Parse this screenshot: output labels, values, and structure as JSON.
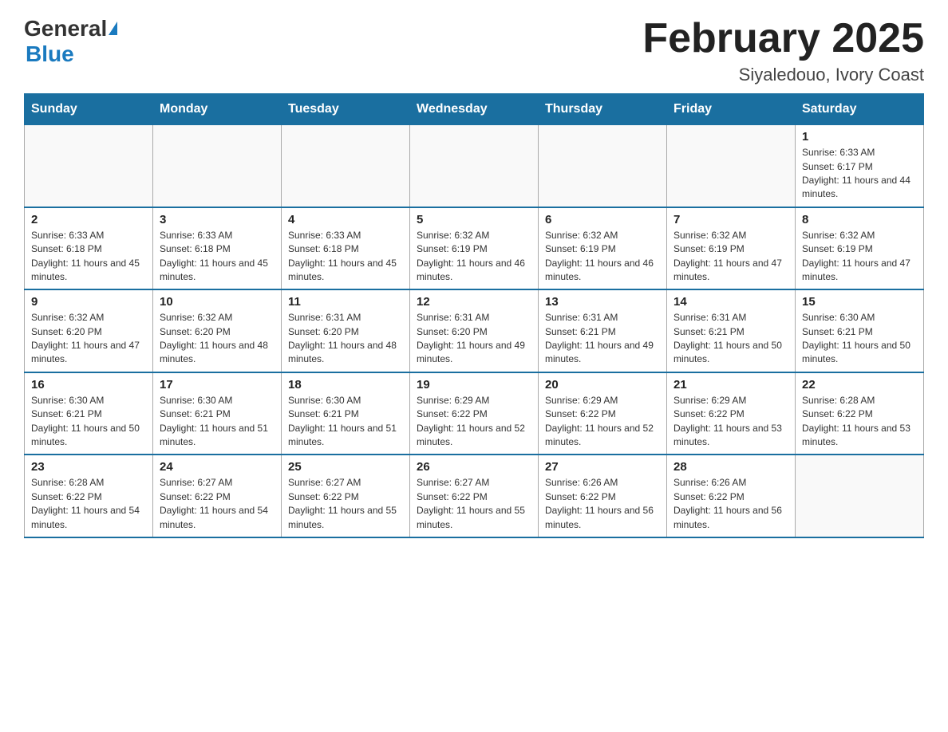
{
  "header": {
    "logo_general": "General",
    "logo_blue": "Blue",
    "month_title": "February 2025",
    "location": "Siyaledouo, Ivory Coast"
  },
  "weekdays": [
    "Sunday",
    "Monday",
    "Tuesday",
    "Wednesday",
    "Thursday",
    "Friday",
    "Saturday"
  ],
  "weeks": [
    [
      {
        "day": "",
        "info": ""
      },
      {
        "day": "",
        "info": ""
      },
      {
        "day": "",
        "info": ""
      },
      {
        "day": "",
        "info": ""
      },
      {
        "day": "",
        "info": ""
      },
      {
        "day": "",
        "info": ""
      },
      {
        "day": "1",
        "info": "Sunrise: 6:33 AM\nSunset: 6:17 PM\nDaylight: 11 hours and 44 minutes."
      }
    ],
    [
      {
        "day": "2",
        "info": "Sunrise: 6:33 AM\nSunset: 6:18 PM\nDaylight: 11 hours and 45 minutes."
      },
      {
        "day": "3",
        "info": "Sunrise: 6:33 AM\nSunset: 6:18 PM\nDaylight: 11 hours and 45 minutes."
      },
      {
        "day": "4",
        "info": "Sunrise: 6:33 AM\nSunset: 6:18 PM\nDaylight: 11 hours and 45 minutes."
      },
      {
        "day": "5",
        "info": "Sunrise: 6:32 AM\nSunset: 6:19 PM\nDaylight: 11 hours and 46 minutes."
      },
      {
        "day": "6",
        "info": "Sunrise: 6:32 AM\nSunset: 6:19 PM\nDaylight: 11 hours and 46 minutes."
      },
      {
        "day": "7",
        "info": "Sunrise: 6:32 AM\nSunset: 6:19 PM\nDaylight: 11 hours and 47 minutes."
      },
      {
        "day": "8",
        "info": "Sunrise: 6:32 AM\nSunset: 6:19 PM\nDaylight: 11 hours and 47 minutes."
      }
    ],
    [
      {
        "day": "9",
        "info": "Sunrise: 6:32 AM\nSunset: 6:20 PM\nDaylight: 11 hours and 47 minutes."
      },
      {
        "day": "10",
        "info": "Sunrise: 6:32 AM\nSunset: 6:20 PM\nDaylight: 11 hours and 48 minutes."
      },
      {
        "day": "11",
        "info": "Sunrise: 6:31 AM\nSunset: 6:20 PM\nDaylight: 11 hours and 48 minutes."
      },
      {
        "day": "12",
        "info": "Sunrise: 6:31 AM\nSunset: 6:20 PM\nDaylight: 11 hours and 49 minutes."
      },
      {
        "day": "13",
        "info": "Sunrise: 6:31 AM\nSunset: 6:21 PM\nDaylight: 11 hours and 49 minutes."
      },
      {
        "day": "14",
        "info": "Sunrise: 6:31 AM\nSunset: 6:21 PM\nDaylight: 11 hours and 50 minutes."
      },
      {
        "day": "15",
        "info": "Sunrise: 6:30 AM\nSunset: 6:21 PM\nDaylight: 11 hours and 50 minutes."
      }
    ],
    [
      {
        "day": "16",
        "info": "Sunrise: 6:30 AM\nSunset: 6:21 PM\nDaylight: 11 hours and 50 minutes."
      },
      {
        "day": "17",
        "info": "Sunrise: 6:30 AM\nSunset: 6:21 PM\nDaylight: 11 hours and 51 minutes."
      },
      {
        "day": "18",
        "info": "Sunrise: 6:30 AM\nSunset: 6:21 PM\nDaylight: 11 hours and 51 minutes."
      },
      {
        "day": "19",
        "info": "Sunrise: 6:29 AM\nSunset: 6:22 PM\nDaylight: 11 hours and 52 minutes."
      },
      {
        "day": "20",
        "info": "Sunrise: 6:29 AM\nSunset: 6:22 PM\nDaylight: 11 hours and 52 minutes."
      },
      {
        "day": "21",
        "info": "Sunrise: 6:29 AM\nSunset: 6:22 PM\nDaylight: 11 hours and 53 minutes."
      },
      {
        "day": "22",
        "info": "Sunrise: 6:28 AM\nSunset: 6:22 PM\nDaylight: 11 hours and 53 minutes."
      }
    ],
    [
      {
        "day": "23",
        "info": "Sunrise: 6:28 AM\nSunset: 6:22 PM\nDaylight: 11 hours and 54 minutes."
      },
      {
        "day": "24",
        "info": "Sunrise: 6:27 AM\nSunset: 6:22 PM\nDaylight: 11 hours and 54 minutes."
      },
      {
        "day": "25",
        "info": "Sunrise: 6:27 AM\nSunset: 6:22 PM\nDaylight: 11 hours and 55 minutes."
      },
      {
        "day": "26",
        "info": "Sunrise: 6:27 AM\nSunset: 6:22 PM\nDaylight: 11 hours and 55 minutes."
      },
      {
        "day": "27",
        "info": "Sunrise: 6:26 AM\nSunset: 6:22 PM\nDaylight: 11 hours and 56 minutes."
      },
      {
        "day": "28",
        "info": "Sunrise: 6:26 AM\nSunset: 6:22 PM\nDaylight: 11 hours and 56 minutes."
      },
      {
        "day": "",
        "info": ""
      }
    ]
  ]
}
